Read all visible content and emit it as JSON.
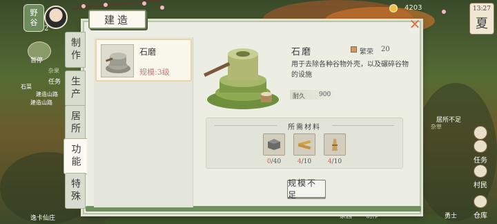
{
  "hud": {
    "season_badge_line1": "野",
    "season_badge_line2": "谷",
    "player_number": "2",
    "map_label": "暂停",
    "faint_left_1": "杂果",
    "task_title": "任务",
    "task_lines": [
      "石菜",
      "建造山路",
      "建造山路"
    ],
    "bottom_left_label": "逸卡仙庄",
    "coin_value": "4203",
    "time": "13:27",
    "season": "夏",
    "right_notice": "居所不足",
    "right_notice_sub": "杂草",
    "right_buttons": [
      "",
      "任务",
      "村民",
      "仓库"
    ],
    "bottom_labels": [
      "家园",
      "制作",
      "勇士",
      "仓库"
    ]
  },
  "dialog": {
    "title": "建造",
    "close_glyph": "✕",
    "tabs": [
      {
        "label": "制作",
        "active": false
      },
      {
        "label": "生产",
        "active": false
      },
      {
        "label": "居所",
        "active": false
      },
      {
        "label": "功能",
        "active": true
      },
      {
        "label": "特殊",
        "active": false
      }
    ],
    "item": {
      "name": "石磨",
      "level": "规模:3级"
    },
    "detail": {
      "name": "石磨",
      "prosperity_label": "繁荣",
      "prosperity_value": "20",
      "description": "用于去除各种谷物外壳，以及碾碎谷物的设施",
      "durability_label": "耐久",
      "durability_value": "900",
      "materials_title": "所需材料",
      "materials": [
        {
          "icon": "stone-block-icon",
          "have": "0",
          "need": "/40"
        },
        {
          "icon": "wood-plank-icon",
          "have": "4",
          "need": "/10"
        },
        {
          "icon": "straw-bundle-icon",
          "have": "4",
          "need": "/10"
        }
      ],
      "build_button": "规模不足"
    }
  }
}
